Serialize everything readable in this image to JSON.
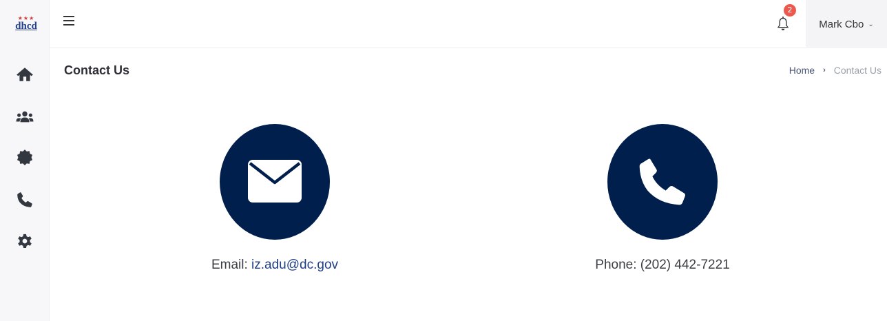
{
  "logo": {
    "text": "dhcd",
    "stars": "★★★"
  },
  "header": {
    "notifications_count": "2",
    "user_name": "Mark Cbo",
    "user_chevron": "⌄"
  },
  "sidebar": {
    "items": [
      {
        "name": "home",
        "icon": "home-icon"
      },
      {
        "name": "users",
        "icon": "users-icon"
      },
      {
        "name": "badge",
        "icon": "badge-icon"
      },
      {
        "name": "contact",
        "icon": "phone-icon"
      },
      {
        "name": "settings",
        "icon": "gear-icon"
      }
    ]
  },
  "page": {
    "title": "Contact Us",
    "breadcrumb": {
      "home": "Home",
      "separator": "›",
      "current": "Contact Us"
    }
  },
  "contact": {
    "email_label": "Email:",
    "email_value": "iz.adu@dc.gov",
    "phone_label": "Phone:",
    "phone_value": "(202) 442-7221"
  },
  "colors": {
    "primary": "#001f4d",
    "badge": "#ec5a4f",
    "link": "#1f3f86"
  }
}
